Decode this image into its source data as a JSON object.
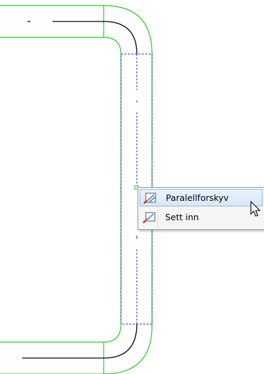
{
  "context_menu": {
    "items": [
      {
        "label": "Paralellforskyv",
        "icon": "parallel-shift-icon",
        "highlighted": true
      },
      {
        "label": "Sett inn",
        "icon": "insert-icon",
        "highlighted": false
      }
    ]
  },
  "colors": {
    "wall_outline": "#22cc22",
    "selection_outline": "#1f2fd0",
    "center_line": "#000000",
    "menu_highlight": "#d7e8fa"
  }
}
